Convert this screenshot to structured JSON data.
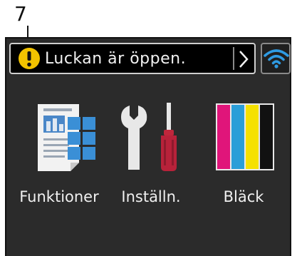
{
  "callout": {
    "number": "7"
  },
  "status": {
    "message": "Luckan är öppen.",
    "icons": {
      "warning": "warning-icon",
      "chevron": "chevron-right-icon",
      "wifi": "wifi-icon"
    }
  },
  "tiles": [
    {
      "label": "Funktioner",
      "icon": "functions-icon"
    },
    {
      "label": "Inställn.",
      "icon": "settings-tools-icon"
    },
    {
      "label": "Bläck",
      "icon": "ink-icon"
    }
  ],
  "colors": {
    "warning": "#f2c300",
    "wifi": "#2f9be3",
    "ink_magenta": "#e0157a",
    "ink_cyan": "#2a9ed8",
    "ink_yellow": "#f5e100",
    "ink_black": "#111111"
  }
}
